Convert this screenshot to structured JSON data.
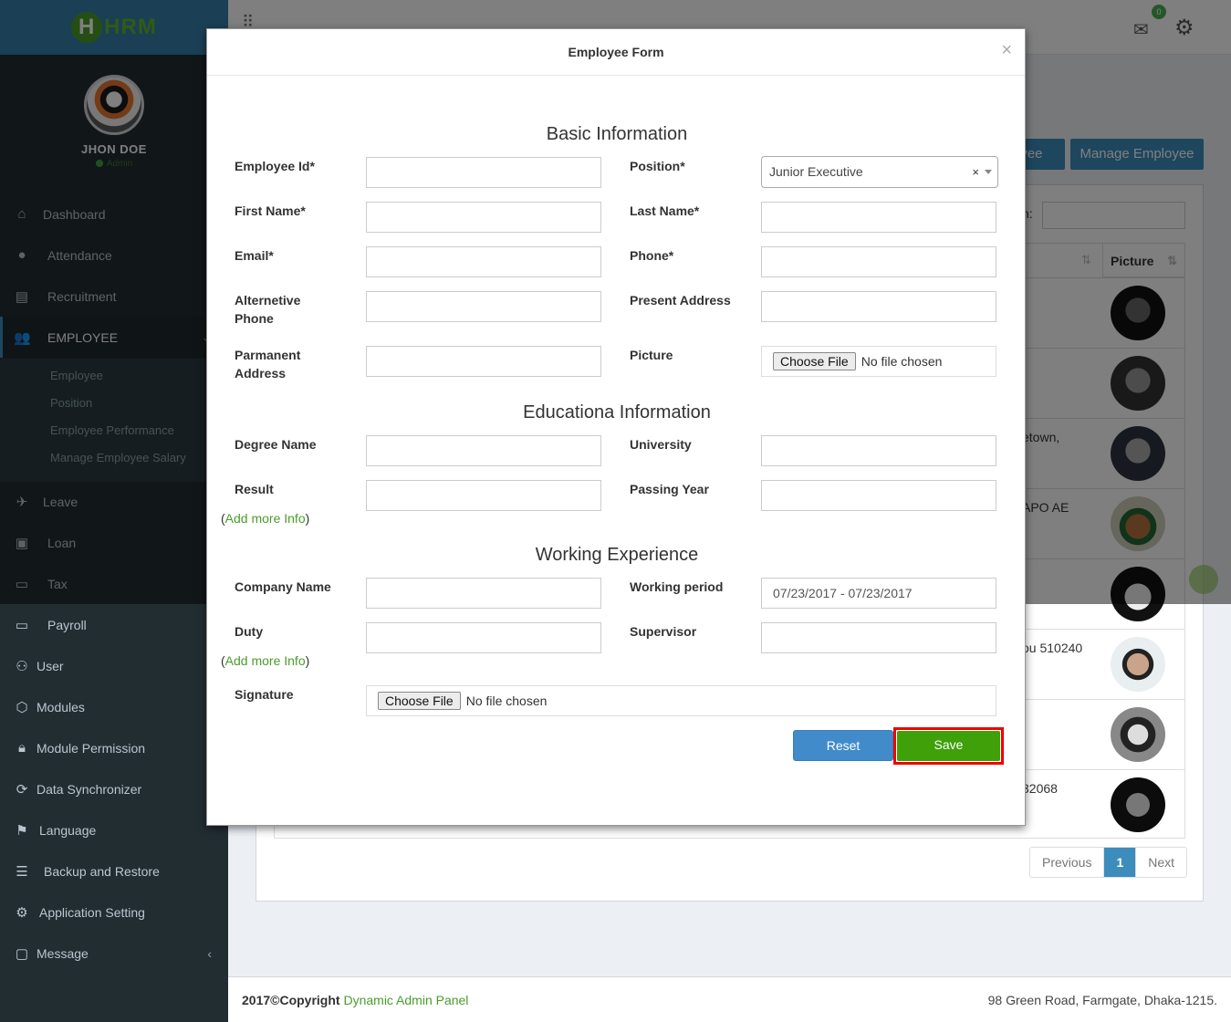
{
  "app": {
    "logo_text": "HRM",
    "logo_letter": "H"
  },
  "user": {
    "name": "JHON DOE",
    "role": "Admin"
  },
  "sidebar": {
    "items": [
      {
        "label": "Dashboard",
        "icon": "home-icon"
      },
      {
        "label": "Attendance",
        "icon": "user-icon"
      },
      {
        "label": "Recruitment",
        "icon": "newspaper-icon"
      },
      {
        "label": "EMPLOYEE",
        "icon": "users-icon"
      },
      {
        "label": "Leave",
        "icon": "plane-icon"
      },
      {
        "label": "Loan",
        "icon": "money-icon"
      },
      {
        "label": "Tax",
        "icon": "card-icon"
      },
      {
        "label": "Payroll",
        "icon": "card-icon"
      },
      {
        "label": "User",
        "icon": "user-icon"
      },
      {
        "label": "Modules",
        "icon": "cube-icon"
      },
      {
        "label": "Module Permission",
        "icon": "lock-icon"
      },
      {
        "label": "Data Synchronizer",
        "icon": "refresh-icon"
      },
      {
        "label": "Language",
        "icon": "language-icon"
      },
      {
        "label": "Backup and Restore",
        "icon": "database-icon"
      },
      {
        "label": "Application Setting",
        "icon": "gear-icon"
      },
      {
        "label": "Message",
        "icon": "comment-icon"
      }
    ],
    "employee_sub": [
      "Employee",
      "Position",
      "Employee Performance",
      "Manage Employee Salary"
    ]
  },
  "topbar": {
    "mail_count": "0"
  },
  "page": {
    "add_button": "oyee",
    "manage_button": "Manage Employee",
    "search_label": "h:",
    "col_picture": "Picture",
    "rows": [
      {
        "addr": ""
      },
      {
        "addr": ""
      },
      {
        "addr": "etown,"
      },
      {
        "addr": "APO AE"
      },
      {
        "addr": ""
      },
      {
        "addr": "ou 510240"
      },
      {
        "addr": ""
      },
      {
        "addr": "32068"
      }
    ],
    "pagination": {
      "prev": "Previous",
      "current": "1",
      "next": "Next"
    }
  },
  "footer": {
    "copyright": "2017©Copyright",
    "link": "Dynamic Admin Panel",
    "address": "98 Green Road, Farmgate, Dhaka-1215."
  },
  "modal": {
    "title": "Employee Form",
    "close": "×",
    "basic_title": "Basic Information",
    "edu_title": "Educationa Information",
    "work_title": "Working Experience",
    "labels": {
      "employee_id": "Employee Id*",
      "position": "Position*",
      "first_name": "First Name*",
      "last_name": "Last Name*",
      "email": "Email*",
      "phone": "Phone*",
      "alt_phone": "Alternetive Phone",
      "present_address": "Present Address",
      "permanent_address": "Parmanent Address",
      "picture": "Picture",
      "degree": "Degree Name",
      "university": "University",
      "result": "Result",
      "passing_year": "Passing Year",
      "company": "Company Name",
      "working_period": "Working period",
      "duty": "Duty",
      "supervisor": "Supervisor",
      "signature": "Signature"
    },
    "values": {
      "position": "Junior Executive",
      "working_period": "07/23/2017 - 07/23/2017"
    },
    "file_button": "Choose File",
    "file_none": "No file chosen",
    "add_more": "Add more Info",
    "reset": "Reset",
    "save": "Save"
  }
}
